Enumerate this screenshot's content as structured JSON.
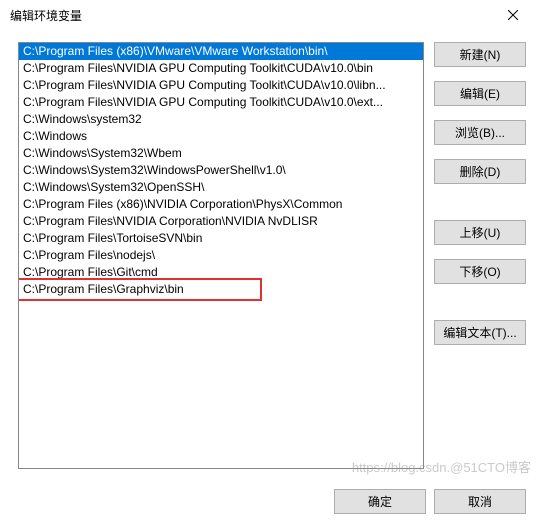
{
  "window": {
    "title": "编辑环境变量"
  },
  "list": {
    "items": [
      "C:\\Program Files (x86)\\VMware\\VMware Workstation\\bin\\",
      "C:\\Program Files\\NVIDIA GPU Computing Toolkit\\CUDA\\v10.0\\bin",
      "C:\\Program Files\\NVIDIA GPU Computing Toolkit\\CUDA\\v10.0\\libn...",
      "C:\\Program Files\\NVIDIA GPU Computing Toolkit\\CUDA\\v10.0\\ext...",
      "C:\\Windows\\system32",
      "C:\\Windows",
      "C:\\Windows\\System32\\Wbem",
      "C:\\Windows\\System32\\WindowsPowerShell\\v1.0\\",
      "C:\\Windows\\System32\\OpenSSH\\",
      "C:\\Program Files (x86)\\NVIDIA Corporation\\PhysX\\Common",
      "C:\\Program Files\\NVIDIA Corporation\\NVIDIA NvDLISR",
      "C:\\Program Files\\TortoiseSVN\\bin",
      "C:\\Program Files\\nodejs\\",
      "C:\\Program Files\\Git\\cmd",
      "C:\\Program Files\\Graphviz\\bin"
    ],
    "selected_index": 0,
    "highlighted_index": 14
  },
  "buttons": {
    "new": "新建(N)",
    "edit": "编辑(E)",
    "browse": "浏览(B)...",
    "delete": "删除(D)",
    "move_up": "上移(U)",
    "move_down": "下移(O)",
    "edit_text": "编辑文本(T)...",
    "ok": "确定",
    "cancel": "取消"
  },
  "watermark": "https://blog.csdn.@51CTO博客"
}
